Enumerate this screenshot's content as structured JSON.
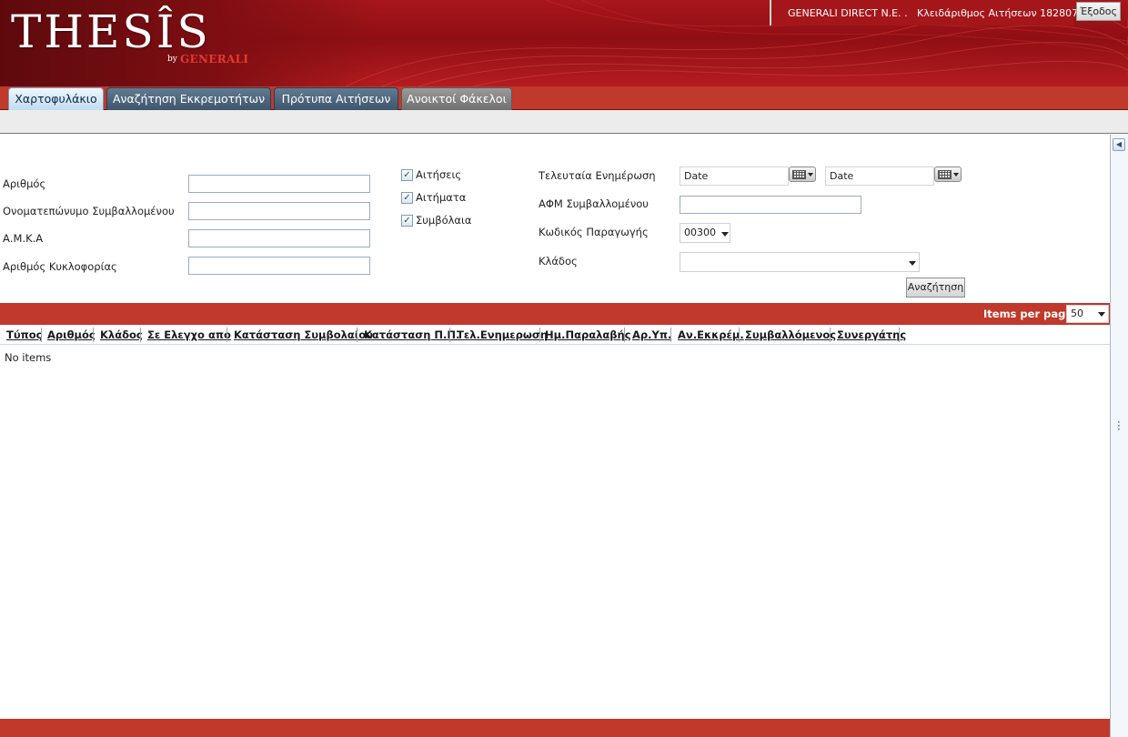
{
  "header": {
    "logo_main": "THESÎS",
    "logo_by": "by",
    "logo_brand": "GENERALI",
    "company": "GENERALI DIRECT N.E. .",
    "request_key": "Κλειδάριθμος Αιτήσεων 182807",
    "exit_label": "Έξοδος"
  },
  "tabs": [
    {
      "label": "Χαρτοφυλάκιο",
      "active": true
    },
    {
      "label": "Αναζήτηση Εκκρεμοτήτων",
      "active": false
    },
    {
      "label": "Πρότυπα Αιτήσεων",
      "active": false
    },
    {
      "label": "Ανοικτοί Φάκελοι",
      "active": false
    }
  ],
  "filters": {
    "number_label": "Αριθμός",
    "number_value": "",
    "insured_name_label": "Ονοματεπώνυμο Συμβαλλομένου",
    "insured_name_value": "",
    "amka_label": "Α.Μ.Κ.Α",
    "amka_value": "",
    "plate_label": "Αριθμός Κυκλοφορίας",
    "plate_value": "",
    "checkboxes": [
      {
        "label": "Αιτήσεις",
        "checked": true
      },
      {
        "label": "Αιτήματα",
        "checked": true
      },
      {
        "label": "Συμβόλαια",
        "checked": true
      }
    ],
    "last_update_label": "Τελευταία Ενημέρωση",
    "date_from": "Date",
    "date_to": "Date",
    "afm_label": "ΑΦΜ Συμβαλλομένου",
    "afm_value": "",
    "production_code_label": "Κωδικός Παραγωγής",
    "production_code_value": "00300",
    "branch_label": "Κλάδος",
    "branch_value": "",
    "search_label": "Αναζήτηση"
  },
  "results": {
    "items_per_page_label": "Items per page:",
    "items_per_page_value": "50",
    "columns": [
      "Τύπος",
      "Αριθμός",
      "Κλάδος",
      "Σε Ελεγχο απο",
      "Κατάσταση Συμβολαίου",
      "Κατάσταση Π.Π.",
      "Τελ.Ενημερωση",
      "Ημ.Παραλαβής",
      "Αρ.Υπ.",
      "Αν.Εκκρέμ.",
      "Συμβαλλόμενος",
      "Συνεργάτης"
    ],
    "empty_text": "No items"
  },
  "colors": {
    "header_red": "#a8161c",
    "bar_red": "#c0392b",
    "tab_blue": "#3d566d",
    "tab_active": "#bfdcf0"
  }
}
